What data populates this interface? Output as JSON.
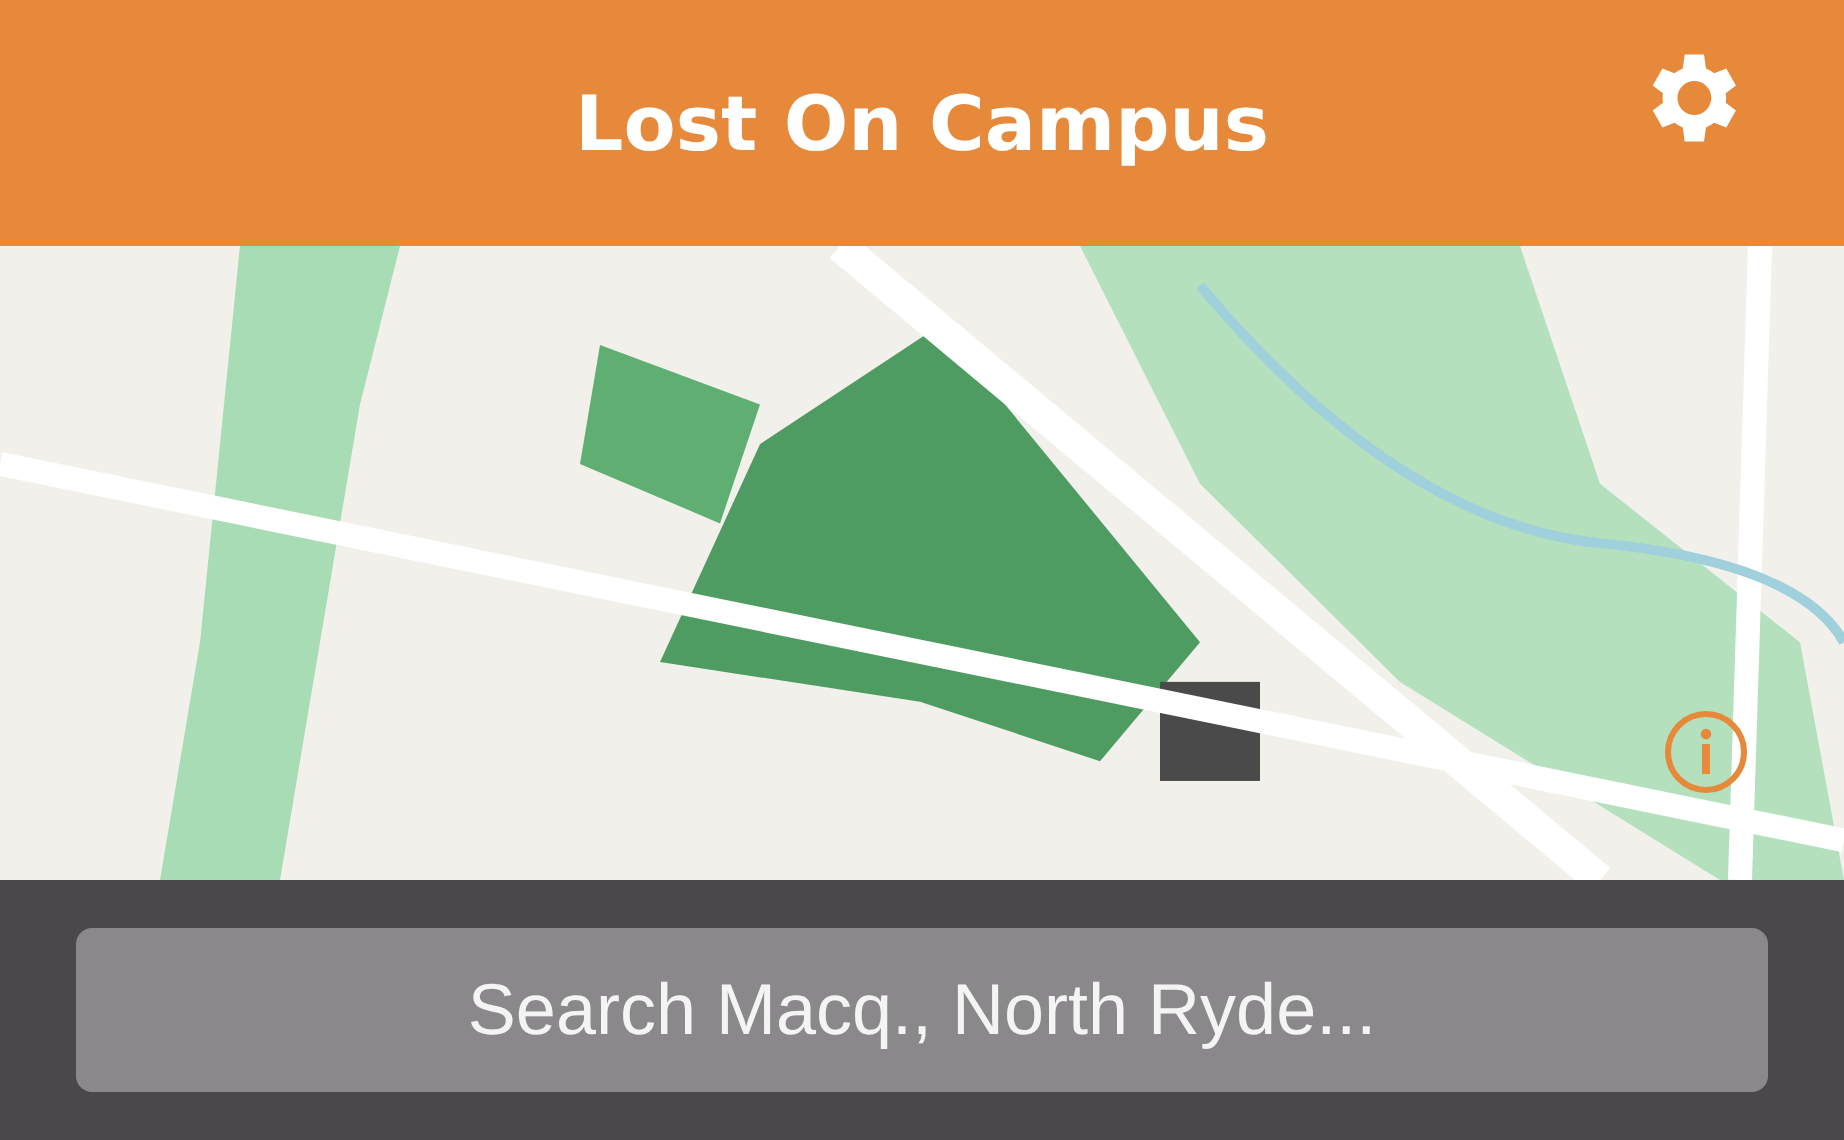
{
  "header": {
    "title": "Lost On Campus"
  },
  "search": {
    "placeholder": "Search Macq., North Ryde..."
  }
}
